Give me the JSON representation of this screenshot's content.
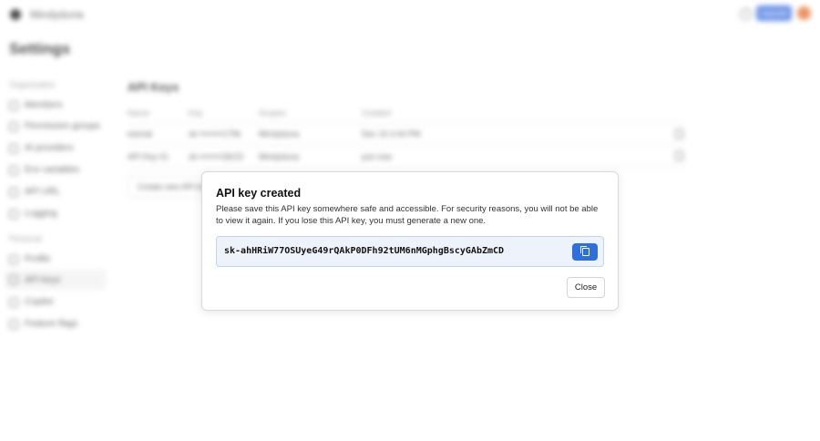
{
  "topbar": {
    "org_name": "Mindyduna",
    "upgrade_label": "Upgrade",
    "help_glyph": "?"
  },
  "page": {
    "title": "Settings"
  },
  "sidebar": {
    "org_section": "Organization",
    "org_items": [
      {
        "label": "Members",
        "icon": "users-icon"
      },
      {
        "label": "Permission groups",
        "icon": "shield-icon"
      },
      {
        "label": "AI providers",
        "icon": "sparkle-icon"
      },
      {
        "label": "Env variables",
        "icon": "code-icon"
      },
      {
        "label": "API URL",
        "icon": "link-icon"
      },
      {
        "label": "Logging",
        "icon": "file-icon"
      }
    ],
    "personal_section": "Personal",
    "personal_items": [
      {
        "label": "Profile",
        "icon": "user-icon"
      },
      {
        "label": "API keys",
        "icon": "key-icon"
      },
      {
        "label": "Copilot",
        "icon": "copilot-icon"
      },
      {
        "label": "Feature flags",
        "icon": "flag-icon"
      }
    ]
  },
  "api_keys": {
    "heading": "API Keys",
    "columns": [
      "Name",
      "Key",
      "Scopes",
      "Created"
    ],
    "rows": [
      {
        "name": "tutorial",
        "key": "sk-••••••••1796",
        "scopes": "Mindyduna",
        "created": "Dec 15 4:44 PM"
      },
      {
        "name": "API Key 01",
        "key": "sk-••••••••2bCD",
        "scopes": "Mindyduna",
        "created": "just now"
      }
    ],
    "create_label": "Create new API key"
  },
  "modal": {
    "title": "API key created",
    "description": "Please save this API key somewhere safe and accessible. For security reasons, you will not be able to view it again. If you lose this API key, you must generate a new one.",
    "api_key": "sk-ahHRiW77OSUyeG49rQAkP0DFh92tUM6nMGphgBscyGAbZmCD",
    "copy_icon": "copy-icon",
    "close_label": "Close"
  },
  "colors": {
    "accent": "#2f6fdd",
    "key_bg": "#eef3fb",
    "avatar": "#e9702e"
  }
}
